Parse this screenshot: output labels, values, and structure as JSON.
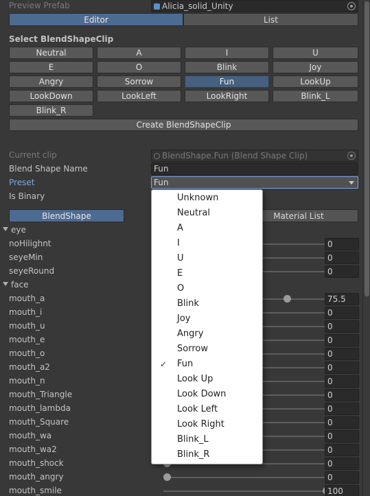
{
  "preview_prefab": {
    "label": "Preview Prefab",
    "value": "Alicia_solid_Unity"
  },
  "tabs": [
    {
      "label": "Editor",
      "active": true
    },
    {
      "label": "List",
      "active": false
    }
  ],
  "select_title": "Select BlendShapeClip",
  "clip_buttons": [
    "Neutral",
    "A",
    "I",
    "U",
    "E",
    "O",
    "Blink",
    "Joy",
    "Angry",
    "Sorrow",
    "Fun",
    "LookUp",
    "LookDown",
    "LookLeft",
    "LookRight",
    "Blink_L",
    "Blink_R"
  ],
  "selected_clip": "Fun",
  "create_button": "Create BlendShapeClip",
  "current_clip": {
    "label": "Current clip",
    "value": "BlendShape.Fun (Blend Shape Clip)"
  },
  "blend_shape_name": {
    "label": "Blend Shape Name",
    "value": "Fun"
  },
  "preset": {
    "label": "Preset",
    "value": "Fun"
  },
  "is_binary": {
    "label": "Is Binary"
  },
  "sub_tabs": [
    {
      "label": "BlendShape",
      "active": true
    },
    {
      "label": "Material List",
      "active": false
    }
  ],
  "groups": [
    {
      "name": "eye",
      "rows": [
        {
          "name": "noHilighnt",
          "value": "0"
        },
        {
          "name": "seyeMin",
          "value": "0"
        },
        {
          "name": "seyeRound",
          "value": "0"
        }
      ]
    },
    {
      "name": "face",
      "rows": [
        {
          "name": "mouth_a",
          "value": "75.5"
        },
        {
          "name": "mouth_i",
          "value": "0"
        },
        {
          "name": "mouth_u",
          "value": "0"
        },
        {
          "name": "mouth_e",
          "value": "0"
        },
        {
          "name": "mouth_o",
          "value": "0"
        },
        {
          "name": "mouth_a2",
          "value": "0"
        },
        {
          "name": "mouth_n",
          "value": "0"
        },
        {
          "name": "mouth_Triangle",
          "value": "0"
        },
        {
          "name": "mouth_lambda",
          "value": "0"
        },
        {
          "name": "mouth_Square",
          "value": "0"
        },
        {
          "name": "mouth_wa",
          "value": "0"
        },
        {
          "name": "mouth_wa2",
          "value": "0"
        },
        {
          "name": "mouth_shock",
          "value": "0"
        },
        {
          "name": "mouth_angry",
          "value": "0"
        },
        {
          "name": "mouth_smile",
          "value": "100"
        }
      ]
    }
  ],
  "slider_levels": {
    "noHilighnt": 0,
    "seyeMin": 0,
    "seyeRound": 0,
    "mouth_a": 0.755,
    "mouth_i": 0,
    "mouth_u": 0,
    "mouth_e": 0,
    "mouth_o": 0,
    "mouth_a2": 0,
    "mouth_n": 0,
    "mouth_Triangle": 0,
    "mouth_lambda": 0,
    "mouth_Square": 0,
    "mouth_wa": 0,
    "mouth_wa2": 0,
    "mouth_shock": 0,
    "mouth_angry": 0,
    "mouth_smile": 1.0
  },
  "preset_menu": {
    "items": [
      "Unknown",
      "Neutral",
      "A",
      "I",
      "U",
      "E",
      "O",
      "Blink",
      "Joy",
      "Angry",
      "Sorrow",
      "Fun",
      "Look Up",
      "Look Down",
      "Look Left",
      "Look Right",
      "Blink_L",
      "Blink_R"
    ],
    "checked": "Fun",
    "check_mark": "✓"
  },
  "colors": {
    "accent": "#46607f",
    "focus_border": "#7ea5df",
    "label_blue": "#7fa8e0"
  }
}
